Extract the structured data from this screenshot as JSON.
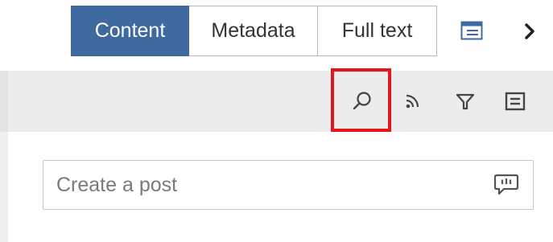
{
  "tabs": [
    {
      "label": "Content",
      "active": true
    },
    {
      "label": "Metadata",
      "active": false
    },
    {
      "label": "Full text",
      "active": false
    }
  ],
  "header_icons": [
    "panel-toggle-icon",
    "chevron-right-icon"
  ],
  "toolbar": {
    "icons": [
      "search-icon",
      "rss-feed-icon",
      "filter-icon",
      "list-view-icon"
    ],
    "highlight_color": "#e8141b"
  },
  "post": {
    "placeholder": "Create a post",
    "value": ""
  },
  "colors": {
    "accent": "#3e6aa0",
    "toolbar_bg": "#ececee"
  }
}
